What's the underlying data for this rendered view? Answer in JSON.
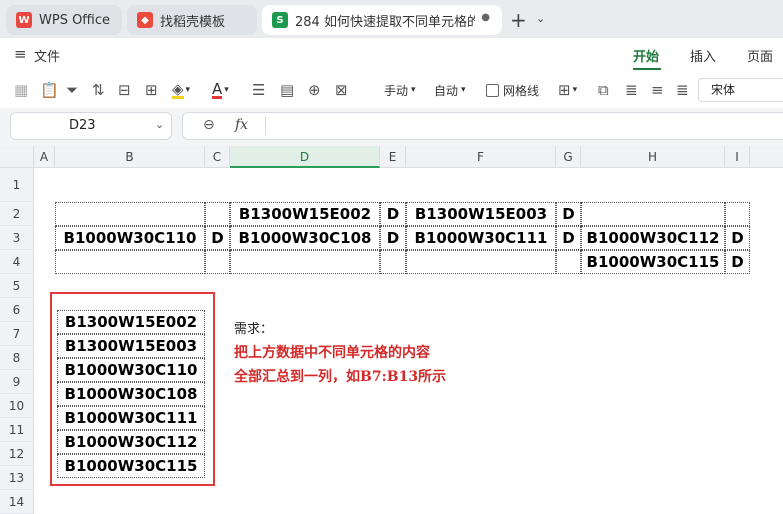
{
  "tabs": [
    {
      "label": "WPS Office",
      "icon": "wps-logo-icon"
    },
    {
      "label": "找稻壳模板",
      "icon": "daoke-icon"
    },
    {
      "label": "284 如何快速提取不同单元格的内",
      "icon": "spreadsheet-icon",
      "icon_letter": "S"
    }
  ],
  "menubar": {
    "file": "文件",
    "items": [
      "开始",
      "插入",
      "页面"
    ]
  },
  "toolbar": {
    "row_height": "手动",
    "auto": "自动",
    "gridlines": "网格线",
    "font": "宋体"
  },
  "formula_bar": {
    "name_box": "D23",
    "fx": "fx",
    "formula": ""
  },
  "columns": [
    "A",
    "B",
    "C",
    "D",
    "E",
    "F",
    "G",
    "H",
    "I"
  ],
  "rows": [
    "1",
    "2",
    "3",
    "4",
    "5",
    "6",
    "7",
    "8",
    "9",
    "10",
    "11",
    "12",
    "13",
    "14"
  ],
  "table": {
    "r2": {
      "d": "B1300W15E002",
      "e": "D",
      "f": "B1300W15E003",
      "g": "D"
    },
    "r3": {
      "b": "B1000W30C110",
      "c": "D",
      "d": "B1000W30C108",
      "e": "D",
      "f": "B1000W30C111",
      "g": "D",
      "h": "B1000W30C112",
      "i": "D"
    },
    "r4": {
      "h": "B1000W30C115",
      "i": "D"
    }
  },
  "result_list": [
    "B1300W15E002",
    "B1300W15E003",
    "B1000W30C110",
    "B1000W30C108",
    "B1000W30C111",
    "B1000W30C112",
    "B1000W30C115"
  ],
  "note": {
    "heading": "需求：",
    "line1": "把上方数据中不同单元格的内容",
    "line2": "全部汇总到一列，如B7:B13所示"
  },
  "colors": {
    "accent": "#1f7a3c",
    "red": "#e23a3a",
    "note_red": "#d42a2a"
  }
}
